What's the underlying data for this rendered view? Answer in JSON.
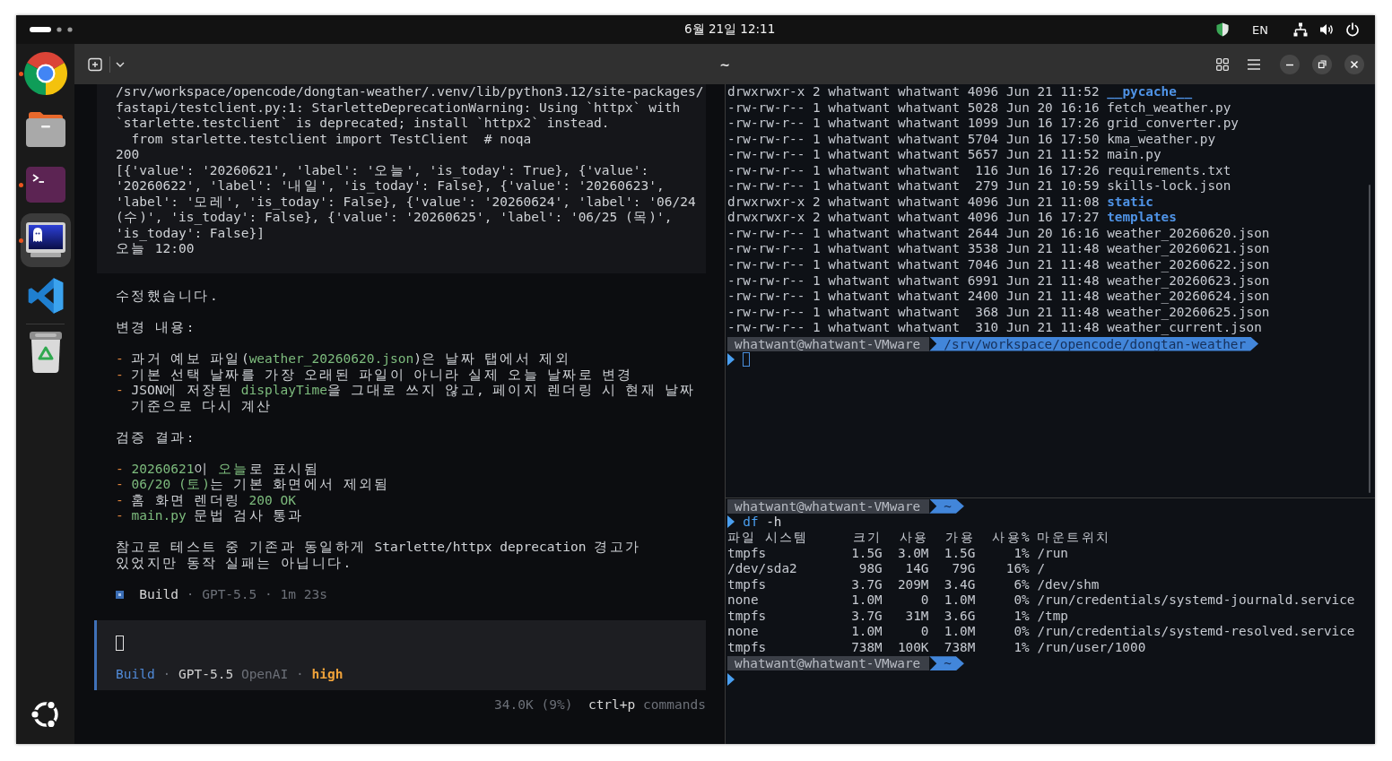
{
  "top_bar": {
    "clock": "6월 21일 12:11",
    "keyboard_layout": "EN"
  },
  "dock": {
    "apps": [
      {
        "kind": "browser",
        "running": true,
        "selected": false
      },
      {
        "kind": "files",
        "running": false,
        "selected": false
      },
      {
        "kind": "terminal",
        "running": true,
        "selected": false
      },
      {
        "kind": "ghost-terminal",
        "running": true,
        "selected": true
      },
      {
        "kind": "code-editor",
        "running": false,
        "selected": false
      },
      {
        "kind": "trash",
        "running": false,
        "selected": false
      }
    ]
  },
  "terminal": {
    "title": "~"
  },
  "left_pane": {
    "output_lines": [
      "/srv/workspace/opencode/dongtan-weather/.venv/lib/python3.12/site-packages/",
      "fastapi/testclient.py:1: StarletteDeprecationWarning: Using `httpx` with",
      "`starlette.testclient` is deprecated; install `httpx2` instead.",
      "  from starlette.testclient import TestClient  # noqa",
      "200",
      "[{'value': '20260621', 'label': '오늘', 'is_today': True}, {'value':",
      "'20260622', 'label': '내일', 'is_today': False}, {'value': '20260623',",
      "'label': '모레', 'is_today': False}, {'value': '20260624', 'label': '06/24",
      "(수)', 'is_today': False}, {'value': '20260625', 'label': '06/25 (목)',",
      "'is_today': False}]",
      "오늘 12:00"
    ],
    "response": {
      "intro": "수정했습니다.",
      "sections": [
        {
          "title": "변경 내용:",
          "items": [
            {
              "marker": "-",
              "lines": [
                [
                  {
                    "text": "과거 예보 파일(",
                    "kind": "plain"
                  },
                  {
                    "text": "weather_20260620.json",
                    "kind": "code"
                  },
                  {
                    "text": ")은 날짜 탭에서 제외",
                    "kind": "plain"
                  }
                ]
              ]
            },
            {
              "marker": "-",
              "lines": [
                [
                  {
                    "text": "기본 선택 날짜를 가장 오래된 파일이 아니라 실제 오늘 날짜로 변경",
                    "kind": "plain"
                  }
                ]
              ]
            },
            {
              "marker": "-",
              "lines": [
                [
                  {
                    "text": "JSON에 저장된 ",
                    "kind": "plain"
                  },
                  {
                    "text": "displayTime",
                    "kind": "code"
                  },
                  {
                    "text": "을 그대로 쓰지 않고, 페이지 렌더링 시 현재 날짜",
                    "kind": "plain"
                  }
                ],
                [
                  {
                    "text": "기준으로 다시 계산",
                    "kind": "plain"
                  }
                ]
              ]
            }
          ]
        },
        {
          "title": "검증 결과:",
          "items": [
            {
              "marker": "-",
              "lines": [
                [
                  {
                    "text": "20260621",
                    "kind": "code"
                  },
                  {
                    "text": "이 ",
                    "kind": "plain"
                  },
                  {
                    "text": "오늘",
                    "kind": "code"
                  },
                  {
                    "text": "로 표시됨",
                    "kind": "plain"
                  }
                ]
              ]
            },
            {
              "marker": "-",
              "lines": [
                [
                  {
                    "text": "06/20 (토)",
                    "kind": "code"
                  },
                  {
                    "text": "는 기본 화면에서 제외됨",
                    "kind": "plain"
                  }
                ]
              ]
            },
            {
              "marker": "-",
              "lines": [
                [
                  {
                    "text": "홈 화면 렌더링 ",
                    "kind": "plain"
                  },
                  {
                    "text": "200 OK",
                    "kind": "code"
                  }
                ]
              ]
            },
            {
              "marker": "-",
              "lines": [
                [
                  {
                    "text": "main.py",
                    "kind": "code"
                  },
                  {
                    "text": " 문법 검사 통과",
                    "kind": "plain"
                  }
                ]
              ]
            }
          ]
        }
      ],
      "note_lines": [
        "참고로 테스트 중 기존과 동일하게 Starlette/httpx deprecation 경고가",
        "있었지만 동작 실패는 아닙니다."
      ]
    },
    "run_summary": [
      {
        "text": "Build",
        "kind": "agent"
      },
      {
        "text": "·",
        "kind": "muted"
      },
      {
        "text": "GPT-5.5",
        "kind": "muted"
      },
      {
        "text": "·",
        "kind": "muted"
      },
      {
        "text": "1m 23s",
        "kind": "muted"
      }
    ],
    "prompt_input": {
      "cursor": true,
      "info": [
        {
          "text": "Build",
          "kind": "agent"
        },
        {
          "text": "·",
          "kind": "muted"
        },
        {
          "text": "GPT-5.5",
          "kind": "model"
        },
        {
          "text": "OpenAI",
          "kind": "muted"
        },
        {
          "text": "·",
          "kind": "muted"
        },
        {
          "text": "high",
          "kind": "effort"
        }
      ]
    },
    "status": {
      "context": "34.0K (9%)",
      "shortcut": [
        {
          "text": "ctrl+p",
          "kind": "key"
        },
        {
          "text": "commands",
          "kind": "muted"
        }
      ]
    }
  },
  "right_top_pane": {
    "listing": [
      {
        "kind": "dir",
        "details": "drwxrwxr-x 2 whatwant whatwant 4096 Jun 21 11:52",
        "name": "__pycache__"
      },
      {
        "kind": "file",
        "details": "-rw-rw-r-- 1 whatwant whatwant 5028 Jun 20 16:16",
        "name": "fetch_weather.py"
      },
      {
        "kind": "file",
        "details": "-rw-rw-r-- 1 whatwant whatwant 1099 Jun 16 17:26",
        "name": "grid_converter.py"
      },
      {
        "kind": "file",
        "details": "-rw-rw-r-- 1 whatwant whatwant 5704 Jun 16 17:50",
        "name": "kma_weather.py"
      },
      {
        "kind": "file",
        "details": "-rw-rw-r-- 1 whatwant whatwant 5657 Jun 21 11:52",
        "name": "main.py"
      },
      {
        "kind": "file",
        "details": "-rw-rw-r-- 1 whatwant whatwant  116 Jun 16 17:26",
        "name": "requirements.txt"
      },
      {
        "kind": "file",
        "details": "-rw-rw-r-- 1 whatwant whatwant  279 Jun 21 10:59",
        "name": "skills-lock.json"
      },
      {
        "kind": "dir",
        "details": "drwxrwxr-x 2 whatwant whatwant 4096 Jun 21 11:08",
        "name": "static"
      },
      {
        "kind": "dir",
        "details": "drwxrwxr-x 2 whatwant whatwant 4096 Jun 16 17:27",
        "name": "templates"
      },
      {
        "kind": "file",
        "details": "-rw-rw-r-- 1 whatwant whatwant 2644 Jun 20 16:16",
        "name": "weather_20260620.json"
      },
      {
        "kind": "file",
        "details": "-rw-rw-r-- 1 whatwant whatwant 3538 Jun 21 11:48",
        "name": "weather_20260621.json"
      },
      {
        "kind": "file",
        "details": "-rw-rw-r-- 1 whatwant whatwant 7046 Jun 21 11:48",
        "name": "weather_20260622.json"
      },
      {
        "kind": "file",
        "details": "-rw-rw-r-- 1 whatwant whatwant 6991 Jun 21 11:48",
        "name": "weather_20260623.json"
      },
      {
        "kind": "file",
        "details": "-rw-rw-r-- 1 whatwant whatwant 2400 Jun 21 11:48",
        "name": "weather_20260624.json"
      },
      {
        "kind": "file",
        "details": "-rw-rw-r-- 1 whatwant whatwant  368 Jun 21 11:48",
        "name": "weather_20260625.json"
      },
      {
        "kind": "file",
        "details": "-rw-rw-r-- 1 whatwant whatwant  310 Jun 21 11:48",
        "name": "weather_current.json"
      }
    ],
    "prompt": {
      "user_host": "whatwant@whatwant-VMware",
      "path": "/srv/workspace/opencode/dongtan-weather",
      "cursor": true
    }
  },
  "right_bottom_pane": {
    "prompt": {
      "user_host": "whatwant@whatwant-VMware",
      "path": "~"
    },
    "command": [
      {
        "text": "df",
        "kind": "command"
      },
      {
        "text": "-h",
        "kind": "argument"
      }
    ],
    "table": {
      "columns": [
        "파일 시스템",
        "크기",
        "사용",
        "가용",
        "사용%",
        "마운트위치"
      ],
      "rows": [
        [
          "tmpfs",
          "1.5G",
          "3.0M",
          "1.5G",
          "1%",
          "/run"
        ],
        [
          "/dev/sda2",
          "98G",
          "14G",
          "79G",
          "16%",
          "/"
        ],
        [
          "tmpfs",
          "3.7G",
          "209M",
          "3.4G",
          "6%",
          "/dev/shm"
        ],
        [
          "none",
          "1.0M",
          "0",
          "1.0M",
          "0%",
          "/run/credentials/systemd-journald.service"
        ],
        [
          "tmpfs",
          "3.7G",
          "31M",
          "3.6G",
          "1%",
          "/tmp"
        ],
        [
          "none",
          "1.0M",
          "0",
          "1.0M",
          "0%",
          "/run/credentials/systemd-resolved.service"
        ],
        [
          "tmpfs",
          "738M",
          "100K",
          "738M",
          "1%",
          "/run/user/1000"
        ]
      ]
    },
    "next_prompt": {
      "user_host": "whatwant@whatwant-VMware",
      "path": "~",
      "cursor": false
    }
  }
}
